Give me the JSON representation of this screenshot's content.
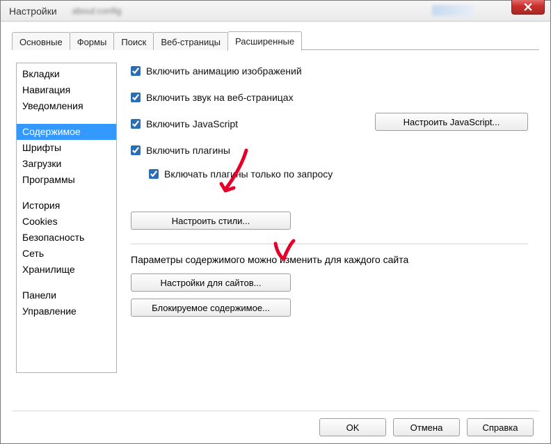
{
  "window": {
    "title": "Настройки",
    "blur_hint": "about:config"
  },
  "tabs": [
    {
      "label": "Основные"
    },
    {
      "label": "Формы"
    },
    {
      "label": "Поиск"
    },
    {
      "label": "Веб-страницы"
    },
    {
      "label": "Расширенные"
    }
  ],
  "sidebar": {
    "groups": [
      [
        "Вкладки",
        "Навигация",
        "Уведомления"
      ],
      [
        "Содержимое",
        "Шрифты",
        "Загрузки",
        "Программы"
      ],
      [
        "История",
        "Cookies",
        "Безопасность",
        "Сеть",
        "Хранилище"
      ],
      [
        "Панели",
        "Управление"
      ]
    ],
    "selected": "Содержимое"
  },
  "options": {
    "enable_image_anim": {
      "label": "Включить анимацию изображений",
      "checked": true
    },
    "enable_sound": {
      "label": "Включить звук на веб-страницах",
      "checked": true
    },
    "enable_js": {
      "label": "Включить JavaScript",
      "checked": true
    },
    "configure_js_btn": "Настроить JavaScript...",
    "enable_plugins": {
      "label": "Включить плагины",
      "checked": true
    },
    "plugins_on_demand": {
      "label": "Включать плагины только по запросу",
      "checked": true
    },
    "configure_styles_btn": "Настроить стили...",
    "per_site_text": "Параметры содержимого можно изменить для каждого сайта",
    "site_settings_btn": "Настройки для сайтов...",
    "blocked_content_btn": "Блокируемое содержимое..."
  },
  "footer": {
    "ok": "OK",
    "cancel": "Отмена",
    "help": "Справка"
  }
}
